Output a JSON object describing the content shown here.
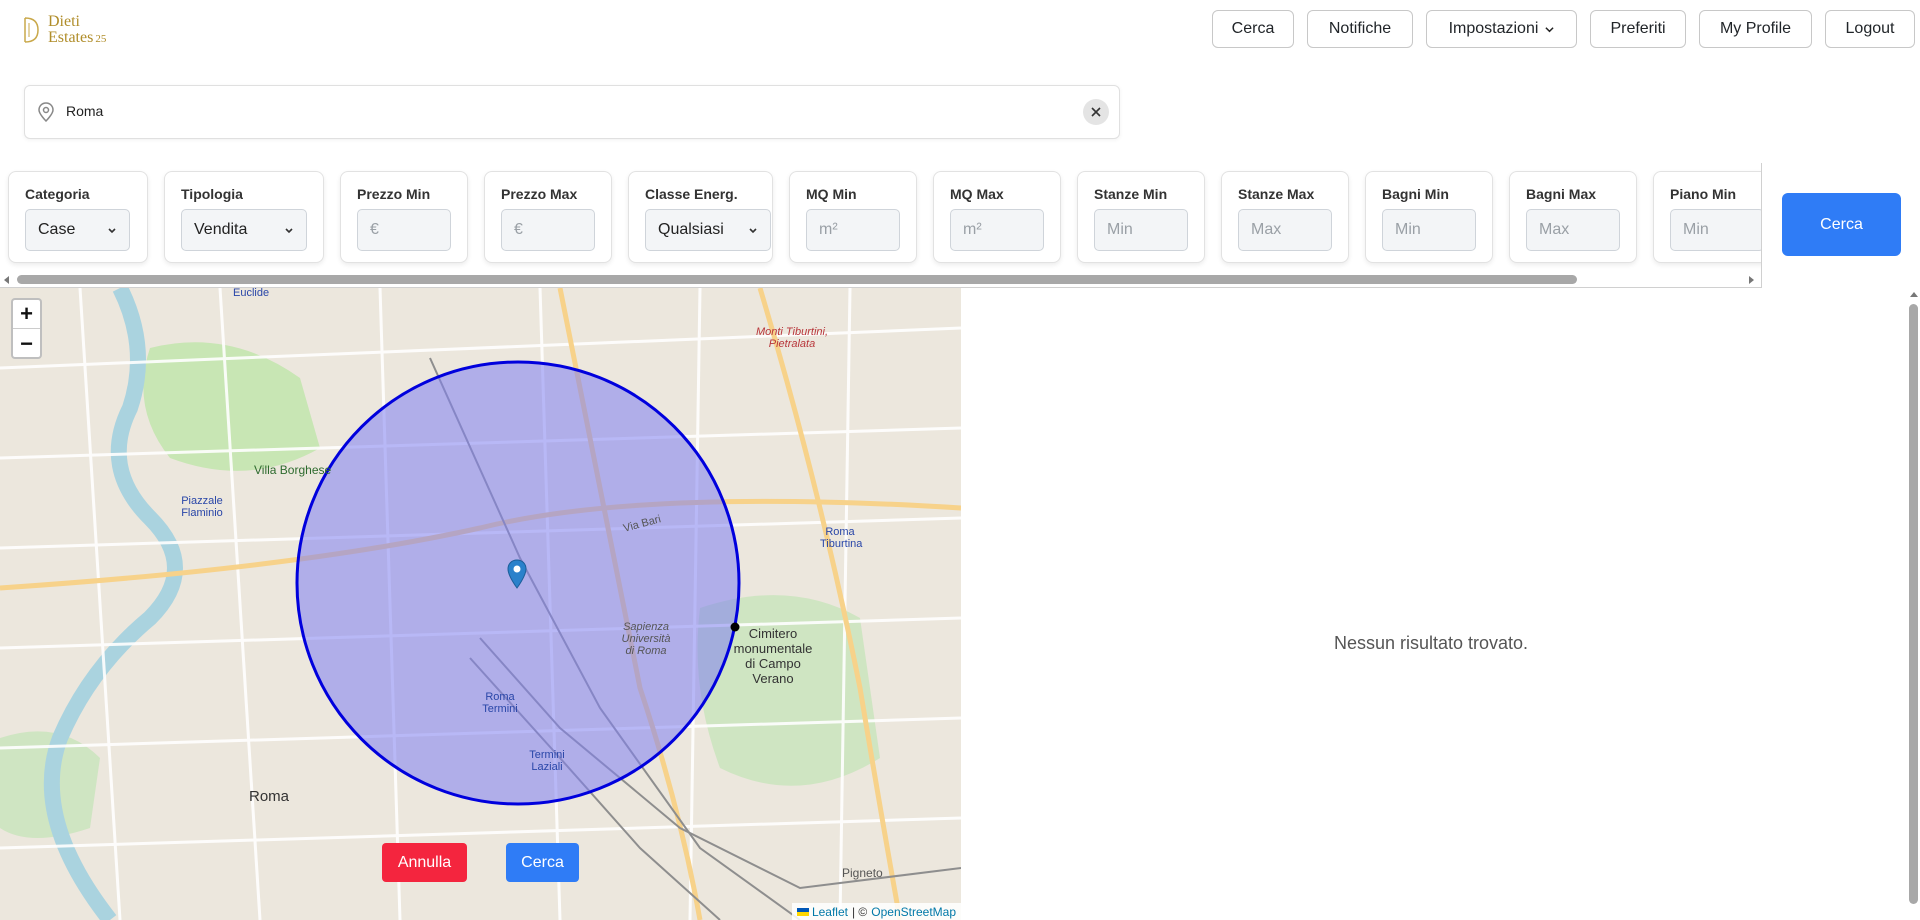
{
  "brand": {
    "line1": "Dieti",
    "line2": "Estates",
    "suffix": "25"
  },
  "nav": {
    "cerca": "Cerca",
    "notifiche": "Notifiche",
    "impostazioni": "Impostazioni",
    "preferiti": "Preferiti",
    "profile": "My Profile",
    "logout": "Logout"
  },
  "search": {
    "value": "Roma"
  },
  "filters": {
    "categoria": {
      "label": "Categoria",
      "value": "Case"
    },
    "tipologia": {
      "label": "Tipologia",
      "value": "Vendita"
    },
    "prezzo_min": {
      "label": "Prezzo Min",
      "placeholder": "€"
    },
    "prezzo_max": {
      "label": "Prezzo Max",
      "placeholder": "€"
    },
    "classe_energ": {
      "label": "Classe Energ.",
      "value": "Qualsiasi"
    },
    "mq_min": {
      "label": "MQ Min",
      "placeholder": "m²"
    },
    "mq_max": {
      "label": "MQ Max",
      "placeholder": "m²"
    },
    "stanze_min": {
      "label": "Stanze Min",
      "placeholder": "Min"
    },
    "stanze_max": {
      "label": "Stanze Max",
      "placeholder": "Max"
    },
    "bagni_min": {
      "label": "Bagni Min",
      "placeholder": "Min"
    },
    "bagni_max": {
      "label": "Bagni Max",
      "placeholder": "Max"
    },
    "piano_min": {
      "label": "Piano Min",
      "placeholder": "Min"
    }
  },
  "cerca_button": "Cerca",
  "map": {
    "zoom_in": "+",
    "zoom_out": "−",
    "annulla": "Annulla",
    "cerca": "Cerca",
    "attribution": {
      "leaflet": "Leaflet",
      "separator": "| ©",
      "osm": "OpenStreetMap"
    },
    "labels": {
      "euclide": "Euclide",
      "flaminio": "Piazzale Flaminio",
      "villa_borghese": "Villa Borghese",
      "roma": "Roma",
      "roma_termini": "Roma Termini",
      "termini_laziali": "Termini Laziali",
      "sapienza": "Sapienza Università di Roma",
      "cimitero": "Cimitero monumentale di Campo Verano",
      "tiburtina": "Roma Tiburtina",
      "pigneto": "Pigneto",
      "via_bari": "Via Bari",
      "monti_tiburtini": "Monti Tiburtini, Pietralata"
    }
  },
  "results": {
    "empty": "Nessun risultato trovato."
  },
  "colors": {
    "primary": "#2f7cf6",
    "danger": "#f4253e",
    "circle": "#0000dd",
    "brand": "#b08d2a"
  }
}
